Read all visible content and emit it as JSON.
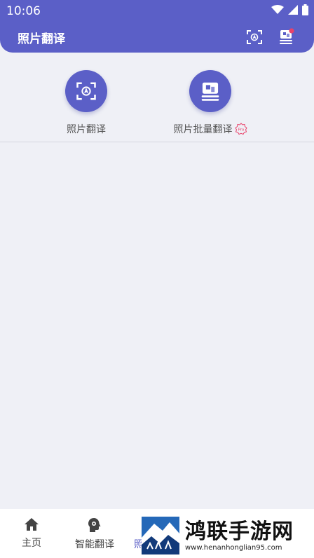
{
  "status_bar": {
    "time": "10:06"
  },
  "header": {
    "title": "照片翻译"
  },
  "tools": [
    {
      "label": "照片翻译"
    },
    {
      "label": "照片批量翻译",
      "badge": "Pro"
    }
  ],
  "bottom_nav": [
    {
      "label": "主页"
    },
    {
      "label": "智能翻译"
    },
    {
      "label": "照"
    }
  ],
  "watermark": {
    "title": "鸿联手游网",
    "url": "www.henanhonglian95.com"
  },
  "colors": {
    "primary": "#5b5fc7",
    "background": "#eff0f6"
  }
}
